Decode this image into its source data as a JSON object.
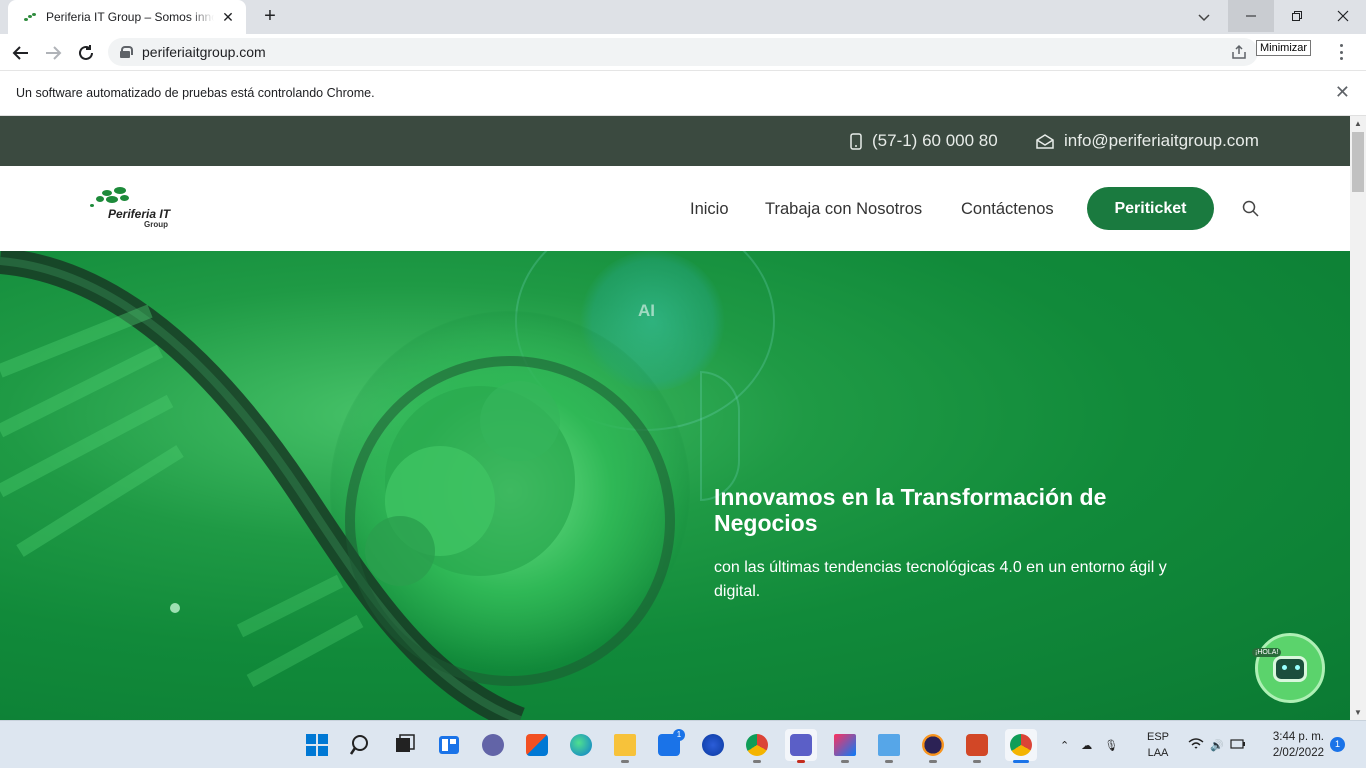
{
  "browser": {
    "tab_title": "Periferia IT Group – Somos innovación",
    "new_tab": "+",
    "url": "periferiaitgroup.com",
    "tooltip": "Minimizar",
    "infobar_message": "Un software automatizado de pruebas está controlando Chrome."
  },
  "site": {
    "phone": "(57-1) 60 000 80",
    "email": "info@periferiaitgroup.com",
    "logo": {
      "name": "Periferia IT",
      "group": "Group"
    },
    "menu": {
      "home": "Inicio",
      "jobs": "Trabaja con Nosotros",
      "contact": "Contáctenos",
      "cta": "Periticket"
    },
    "hero": {
      "title": "Innovamos en la Transformación de Negocios",
      "subtitle": "con las últimas tendencias tecnológicas 4.0 en un entorno ágil y digital.",
      "ai_label": "AI"
    },
    "chatbot_label": "¡HOLA!"
  },
  "taskbar": {
    "language": "ESP",
    "layout": "LAA",
    "time": "3:44 p. m.",
    "date": "2/02/2022",
    "mail_badge": "1",
    "notification_count": "1"
  },
  "colors": {
    "topbar": "#3b4a40",
    "brand_green": "#1a7a3f",
    "hero_green": "#118a3a"
  }
}
